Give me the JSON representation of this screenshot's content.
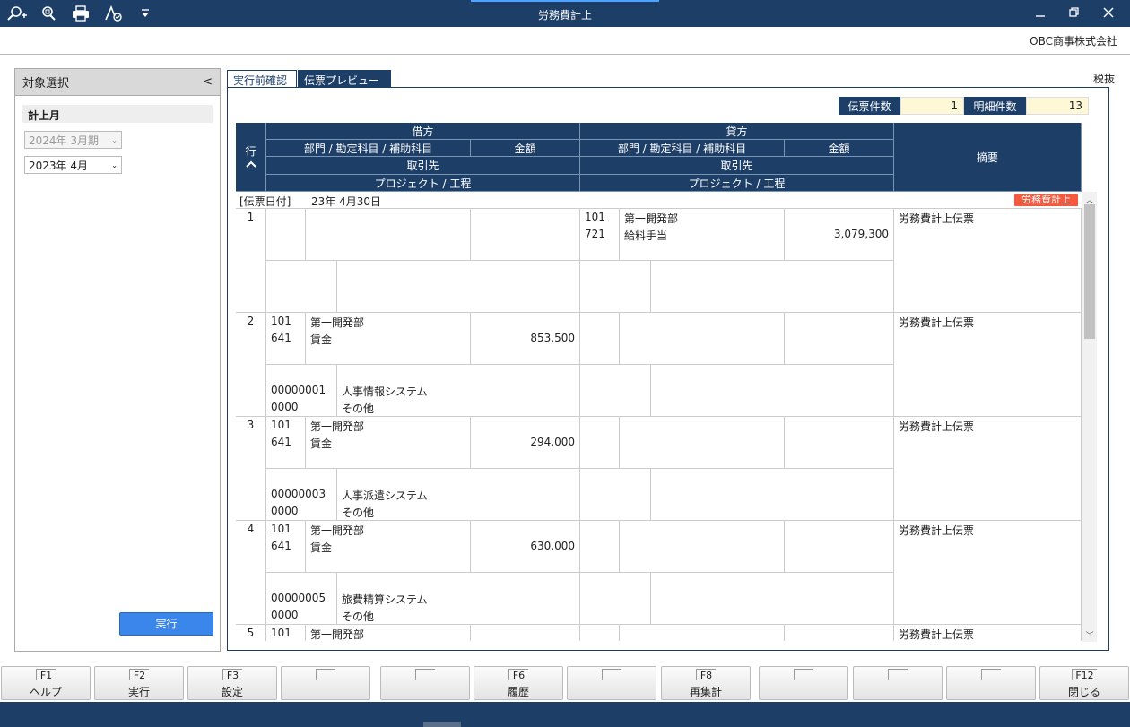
{
  "window": {
    "title": "労務費計上",
    "company": "OBC商事株式会社"
  },
  "toolbar": {
    "icons": [
      "search-add-icon",
      "search-zoom-icon",
      "print-icon",
      "approve-icon",
      "dropdown-arrow-icon"
    ]
  },
  "left_panel": {
    "title": "対象選択",
    "collapse": "<",
    "section": "計上月",
    "period_select": "2024年  3月期",
    "month_select": "2023年  4月",
    "exec_button": "実行"
  },
  "tabs": [
    {
      "label": "実行前確認",
      "active": false
    },
    {
      "label": "伝票プレビュー",
      "active": true
    }
  ],
  "tax_label": "税抜",
  "counts": {
    "voucher_label": "伝票件数",
    "voucher_value": "1",
    "detail_label": "明細件数",
    "detail_value": "13"
  },
  "table_header": {
    "row_label": "行",
    "debit": "借方",
    "credit": "貸方",
    "dept_account": "部門 / 勘定科目 / 補助科目",
    "amount": "金額",
    "partner": "取引先",
    "project": "プロジェクト / 工程",
    "summary": "摘要"
  },
  "voucher": {
    "date_label": "[伝票日付]",
    "date": "23年  4月30日",
    "badge": "労務費計上"
  },
  "rows": [
    {
      "no": "1",
      "d_dept_code": "",
      "d_dept": "",
      "d_acct_code": "",
      "d_acct": "",
      "d_amount": "",
      "d_proj_code": "",
      "d_proj": "",
      "d_proc_code": "",
      "d_proc": "",
      "c_dept_code": "101",
      "c_dept": "第一開発部",
      "c_acct_code": "721",
      "c_acct": "給料手当",
      "c_amount": "3,079,300",
      "summary": "労務費計上伝票"
    },
    {
      "no": "2",
      "d_dept_code": "101",
      "d_dept": "第一開発部",
      "d_acct_code": "641",
      "d_acct": "賃金",
      "d_amount": "853,500",
      "d_proj_code": "00000001",
      "d_proj": "人事情報システム",
      "d_proc_code": "0000",
      "d_proc": "その他",
      "c_dept_code": "",
      "c_dept": "",
      "c_acct_code": "",
      "c_acct": "",
      "c_amount": "",
      "summary": "労務費計上伝票"
    },
    {
      "no": "3",
      "d_dept_code": "101",
      "d_dept": "第一開発部",
      "d_acct_code": "641",
      "d_acct": "賃金",
      "d_amount": "294,000",
      "d_proj_code": "00000003",
      "d_proj": "人事派遣システム",
      "d_proc_code": "0000",
      "d_proc": "その他",
      "c_dept_code": "",
      "c_dept": "",
      "c_acct_code": "",
      "c_acct": "",
      "c_amount": "",
      "summary": "労務費計上伝票"
    },
    {
      "no": "4",
      "d_dept_code": "101",
      "d_dept": "第一開発部",
      "d_acct_code": "641",
      "d_acct": "賃金",
      "d_amount": "630,000",
      "d_proj_code": "00000005",
      "d_proj": "旅費精算システム",
      "d_proc_code": "0000",
      "d_proc": "その他",
      "c_dept_code": "",
      "c_dept": "",
      "c_acct_code": "",
      "c_acct": "",
      "c_amount": "",
      "summary": "労務費計上伝票"
    },
    {
      "no": "5",
      "d_dept_code": "101",
      "d_dept": "第一開発部",
      "d_acct_code": "",
      "d_acct": "",
      "d_amount": "",
      "d_proj_code": "",
      "d_proj": "",
      "d_proc_code": "",
      "d_proc": "",
      "c_dept_code": "",
      "c_dept": "",
      "c_acct_code": "",
      "c_acct": "",
      "c_amount": "",
      "summary": "労務費計上伝票"
    }
  ],
  "fkeys": [
    {
      "key": "F1",
      "label": "ヘルプ"
    },
    {
      "key": "F2",
      "label": "実行"
    },
    {
      "key": "F3",
      "label": "設定"
    },
    {
      "key": "",
      "label": ""
    },
    {
      "key": "",
      "label": ""
    },
    {
      "key": "F6",
      "label": "履歴"
    },
    {
      "key": "",
      "label": ""
    },
    {
      "key": "F8",
      "label": "再集計"
    },
    {
      "key": "",
      "label": ""
    },
    {
      "key": "",
      "label": ""
    },
    {
      "key": "",
      "label": ""
    },
    {
      "key": "F12",
      "label": "閉じる"
    }
  ]
}
